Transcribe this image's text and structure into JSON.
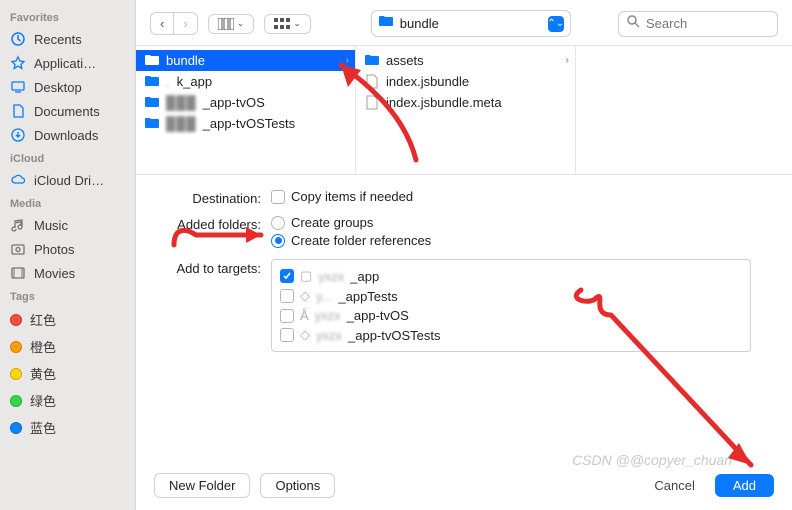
{
  "sidebar": {
    "sections": [
      {
        "title": "Favorites",
        "items": [
          {
            "name": "Recents",
            "icon": "clock"
          },
          {
            "name": "Applicati…",
            "icon": "app"
          },
          {
            "name": "Desktop",
            "icon": "desktop"
          },
          {
            "name": "Documents",
            "icon": "doc"
          },
          {
            "name": "Downloads",
            "icon": "download"
          }
        ]
      },
      {
        "title": "iCloud",
        "items": [
          {
            "name": "iCloud Dri…",
            "icon": "cloud"
          }
        ]
      },
      {
        "title": "Media",
        "items": [
          {
            "name": "Music",
            "icon": "music"
          },
          {
            "name": "Photos",
            "icon": "photo"
          },
          {
            "name": "Movies",
            "icon": "movie"
          }
        ]
      },
      {
        "title": "Tags",
        "items": [
          {
            "name": "红色",
            "color": "#ff4b41"
          },
          {
            "name": "橙色",
            "color": "#ff9f0a"
          },
          {
            "name": "黄色",
            "color": "#ffd60a"
          },
          {
            "name": "绿色",
            "color": "#32d74b"
          },
          {
            "name": "蓝色",
            "color": "#0a84ff"
          }
        ]
      }
    ]
  },
  "toolbar": {
    "path_label": "bundle",
    "search_placeholder": "Search"
  },
  "browser": {
    "col1": [
      {
        "label": "bundle",
        "type": "folder",
        "selected": true,
        "chev": true
      },
      {
        "label": "k_app",
        "type": "folder",
        "blurPrefix": ". "
      },
      {
        "label": "_app-tvOS",
        "type": "folder",
        "blurPrefix": "███"
      },
      {
        "label": "_app-tvOSTests",
        "type": "folder",
        "blurPrefix": "███"
      }
    ],
    "col2": [
      {
        "label": "assets",
        "type": "folder",
        "chev": true
      },
      {
        "label": "index.jsbundle",
        "type": "file"
      },
      {
        "label": "index.jsbundle.meta",
        "type": "file"
      }
    ]
  },
  "form": {
    "destination_label": "Destination:",
    "copy_items": "Copy items if needed",
    "added_folders_label": "Added folders:",
    "create_groups": "Create groups",
    "create_refs": "Create folder references",
    "add_targets_label": "Add to targets:",
    "targets": [
      {
        "name": "_app",
        "checked": true
      },
      {
        "name": "_appTests",
        "checked": false
      },
      {
        "name": "_app-tvOS",
        "checked": false
      },
      {
        "name": "_app-tvOSTests",
        "checked": false
      }
    ]
  },
  "footer": {
    "new_folder": "New Folder",
    "options": "Options",
    "cancel": "Cancel",
    "add": "Add"
  },
  "watermark": "CSDN @@copyer_chuan"
}
